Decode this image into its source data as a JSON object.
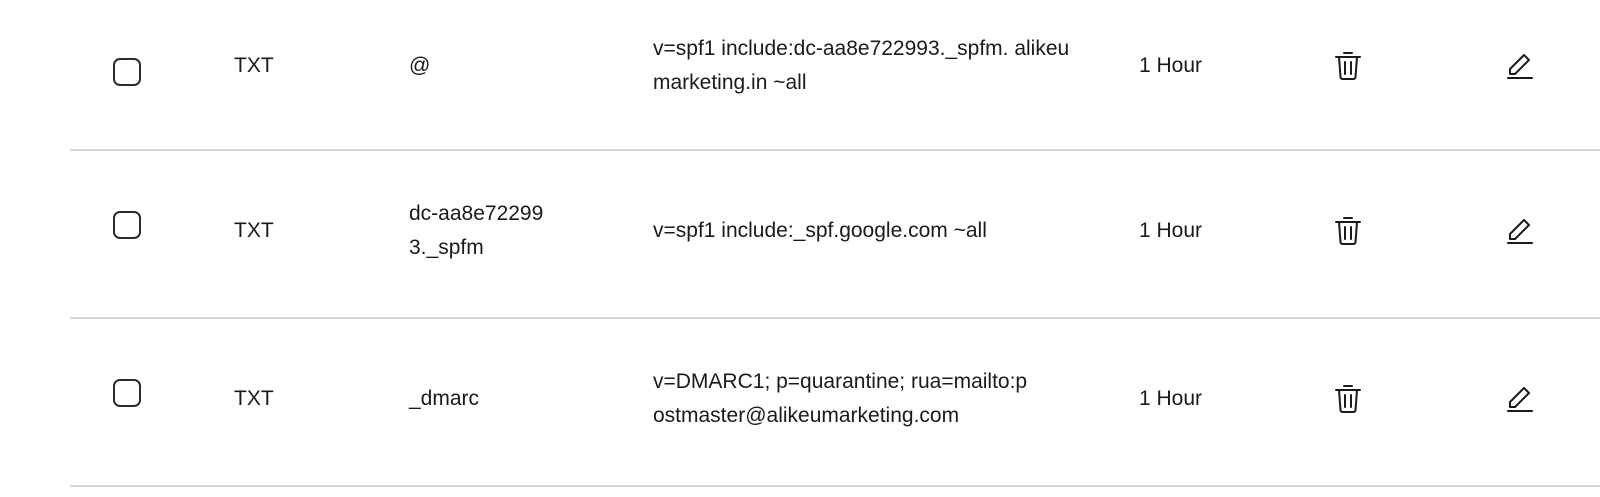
{
  "dns_records": [
    {
      "type": "TXT",
      "name": "@",
      "value": "v=spf1 include:dc-aa8e722993._spfm. alikeumarketing.in ~all",
      "ttl": "1 Hour"
    },
    {
      "type": "TXT",
      "name": "dc-aa8e722993._spfm",
      "value": "v=spf1 include:_spf.google.com ~all",
      "ttl": "1 Hour"
    },
    {
      "type": "TXT",
      "name": "_dmarc",
      "value": "v=DMARC1; p=quarantine; rua=mailto:postmaster@alikeumarketing.com",
      "ttl": "1 Hour"
    }
  ],
  "icons": {
    "delete": "trash-icon",
    "edit": "pencil-icon"
  }
}
